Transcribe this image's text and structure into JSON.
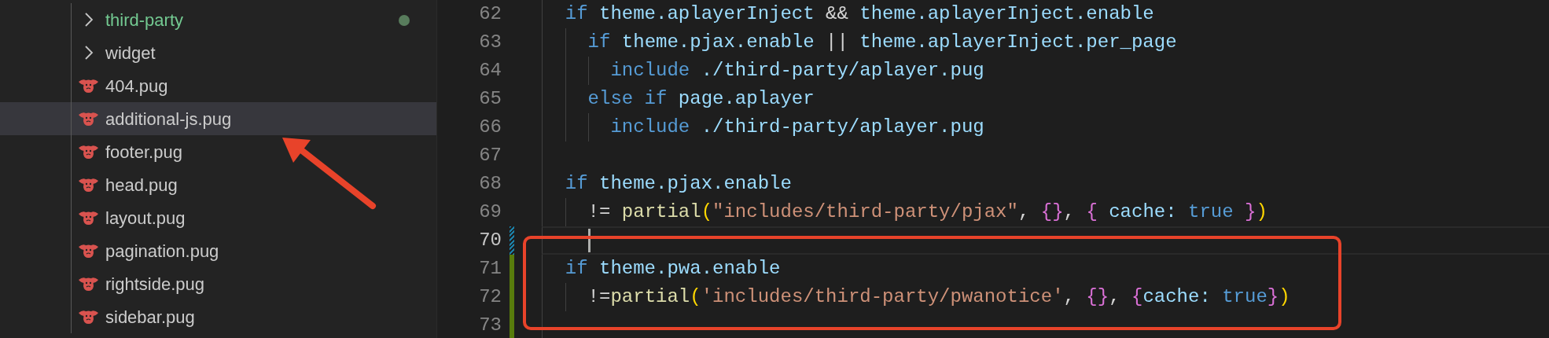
{
  "sidebar": {
    "items": [
      {
        "kind": "folder",
        "label": "third-party",
        "modified": true,
        "selected": false
      },
      {
        "kind": "folder",
        "label": "widget",
        "modified": false,
        "selected": false
      },
      {
        "kind": "file",
        "label": "404.pug",
        "modified": false,
        "selected": false
      },
      {
        "kind": "file",
        "label": "additional-js.pug",
        "modified": false,
        "selected": true
      },
      {
        "kind": "file",
        "label": "footer.pug",
        "modified": false,
        "selected": false
      },
      {
        "kind": "file",
        "label": "head.pug",
        "modified": false,
        "selected": false
      },
      {
        "kind": "file",
        "label": "layout.pug",
        "modified": false,
        "selected": false
      },
      {
        "kind": "file",
        "label": "pagination.pug",
        "modified": false,
        "selected": false
      },
      {
        "kind": "file",
        "label": "rightside.pug",
        "modified": false,
        "selected": false
      },
      {
        "kind": "file",
        "label": "sidebar.pug",
        "modified": false,
        "selected": false
      }
    ]
  },
  "editor": {
    "lines": [
      {
        "number": "62",
        "current": false,
        "modified": false,
        "added": false,
        "tokens": [
          {
            "text": "  if",
            "kind": "kw"
          },
          {
            "text": " theme.aplayerInject ",
            "kind": "var"
          },
          {
            "text": "&&",
            "kind": "op"
          },
          {
            "text": " theme.aplayerInject.enable",
            "kind": "var"
          }
        ]
      },
      {
        "number": "63",
        "current": false,
        "modified": false,
        "added": false,
        "tokens": [
          {
            "text": "    if",
            "kind": "kw"
          },
          {
            "text": " theme.pjax.enable ",
            "kind": "var"
          },
          {
            "text": "||",
            "kind": "op"
          },
          {
            "text": " theme.aplayerInject.per_page",
            "kind": "var"
          }
        ]
      },
      {
        "number": "64",
        "current": false,
        "modified": false,
        "added": false,
        "tokens": [
          {
            "text": "      include",
            "kind": "kw"
          },
          {
            "text": " ./third-party/aplayer.pug",
            "kind": "var"
          }
        ]
      },
      {
        "number": "65",
        "current": false,
        "modified": false,
        "added": false,
        "tokens": [
          {
            "text": "    else if",
            "kind": "kw"
          },
          {
            "text": " page.aplayer",
            "kind": "var"
          }
        ]
      },
      {
        "number": "66",
        "current": false,
        "modified": false,
        "added": false,
        "tokens": [
          {
            "text": "      include",
            "kind": "kw"
          },
          {
            "text": " ./third-party/aplayer.pug",
            "kind": "var"
          }
        ]
      },
      {
        "number": "67",
        "current": false,
        "modified": false,
        "added": false
      },
      {
        "number": "68",
        "current": false,
        "modified": false,
        "added": false,
        "tokens": [
          {
            "text": "  if",
            "kind": "kw"
          },
          {
            "text": " theme.pjax.enable",
            "kind": "var"
          }
        ]
      },
      {
        "number": "69",
        "current": false,
        "modified": false,
        "added": false,
        "tokens": [
          {
            "text": "    != ",
            "kind": "op"
          },
          {
            "text": "partial",
            "kind": "fn"
          },
          {
            "text": "(",
            "kind": "paren"
          },
          {
            "text": "\"includes/third-party/pjax\"",
            "kind": "str"
          },
          {
            "text": ", ",
            "kind": "op"
          },
          {
            "text": "{}",
            "kind": "brace"
          },
          {
            "text": ", ",
            "kind": "op"
          },
          {
            "text": "{",
            "kind": "brace"
          },
          {
            "text": " cache: ",
            "kind": "var"
          },
          {
            "text": "true",
            "kind": "bool"
          },
          {
            "text": " }",
            "kind": "brace"
          },
          {
            "text": ")",
            "kind": "paren"
          }
        ]
      },
      {
        "number": "70",
        "current": true,
        "modified": true,
        "added": false
      },
      {
        "number": "71",
        "current": false,
        "modified": false,
        "added": true,
        "tokens": [
          {
            "text": "  if",
            "kind": "kw"
          },
          {
            "text": " theme.pwa.enable",
            "kind": "var"
          }
        ]
      },
      {
        "number": "72",
        "current": false,
        "modified": false,
        "added": true,
        "tokens": [
          {
            "text": "    !=",
            "kind": "op"
          },
          {
            "text": "partial",
            "kind": "fn"
          },
          {
            "text": "(",
            "kind": "paren"
          },
          {
            "text": "'includes/third-party/pwanotice'",
            "kind": "str"
          },
          {
            "text": ", ",
            "kind": "op"
          },
          {
            "text": "{}",
            "kind": "brace"
          },
          {
            "text": ", ",
            "kind": "op"
          },
          {
            "text": "{",
            "kind": "brace"
          },
          {
            "text": "cache: ",
            "kind": "var"
          },
          {
            "text": "true",
            "kind": "bool"
          },
          {
            "text": "}",
            "kind": "brace"
          },
          {
            "text": ")",
            "kind": "paren"
          }
        ]
      },
      {
        "number": "73",
        "current": false,
        "modified": false,
        "added": true
      }
    ]
  },
  "annotations": {
    "arrow": true,
    "frame": true
  }
}
